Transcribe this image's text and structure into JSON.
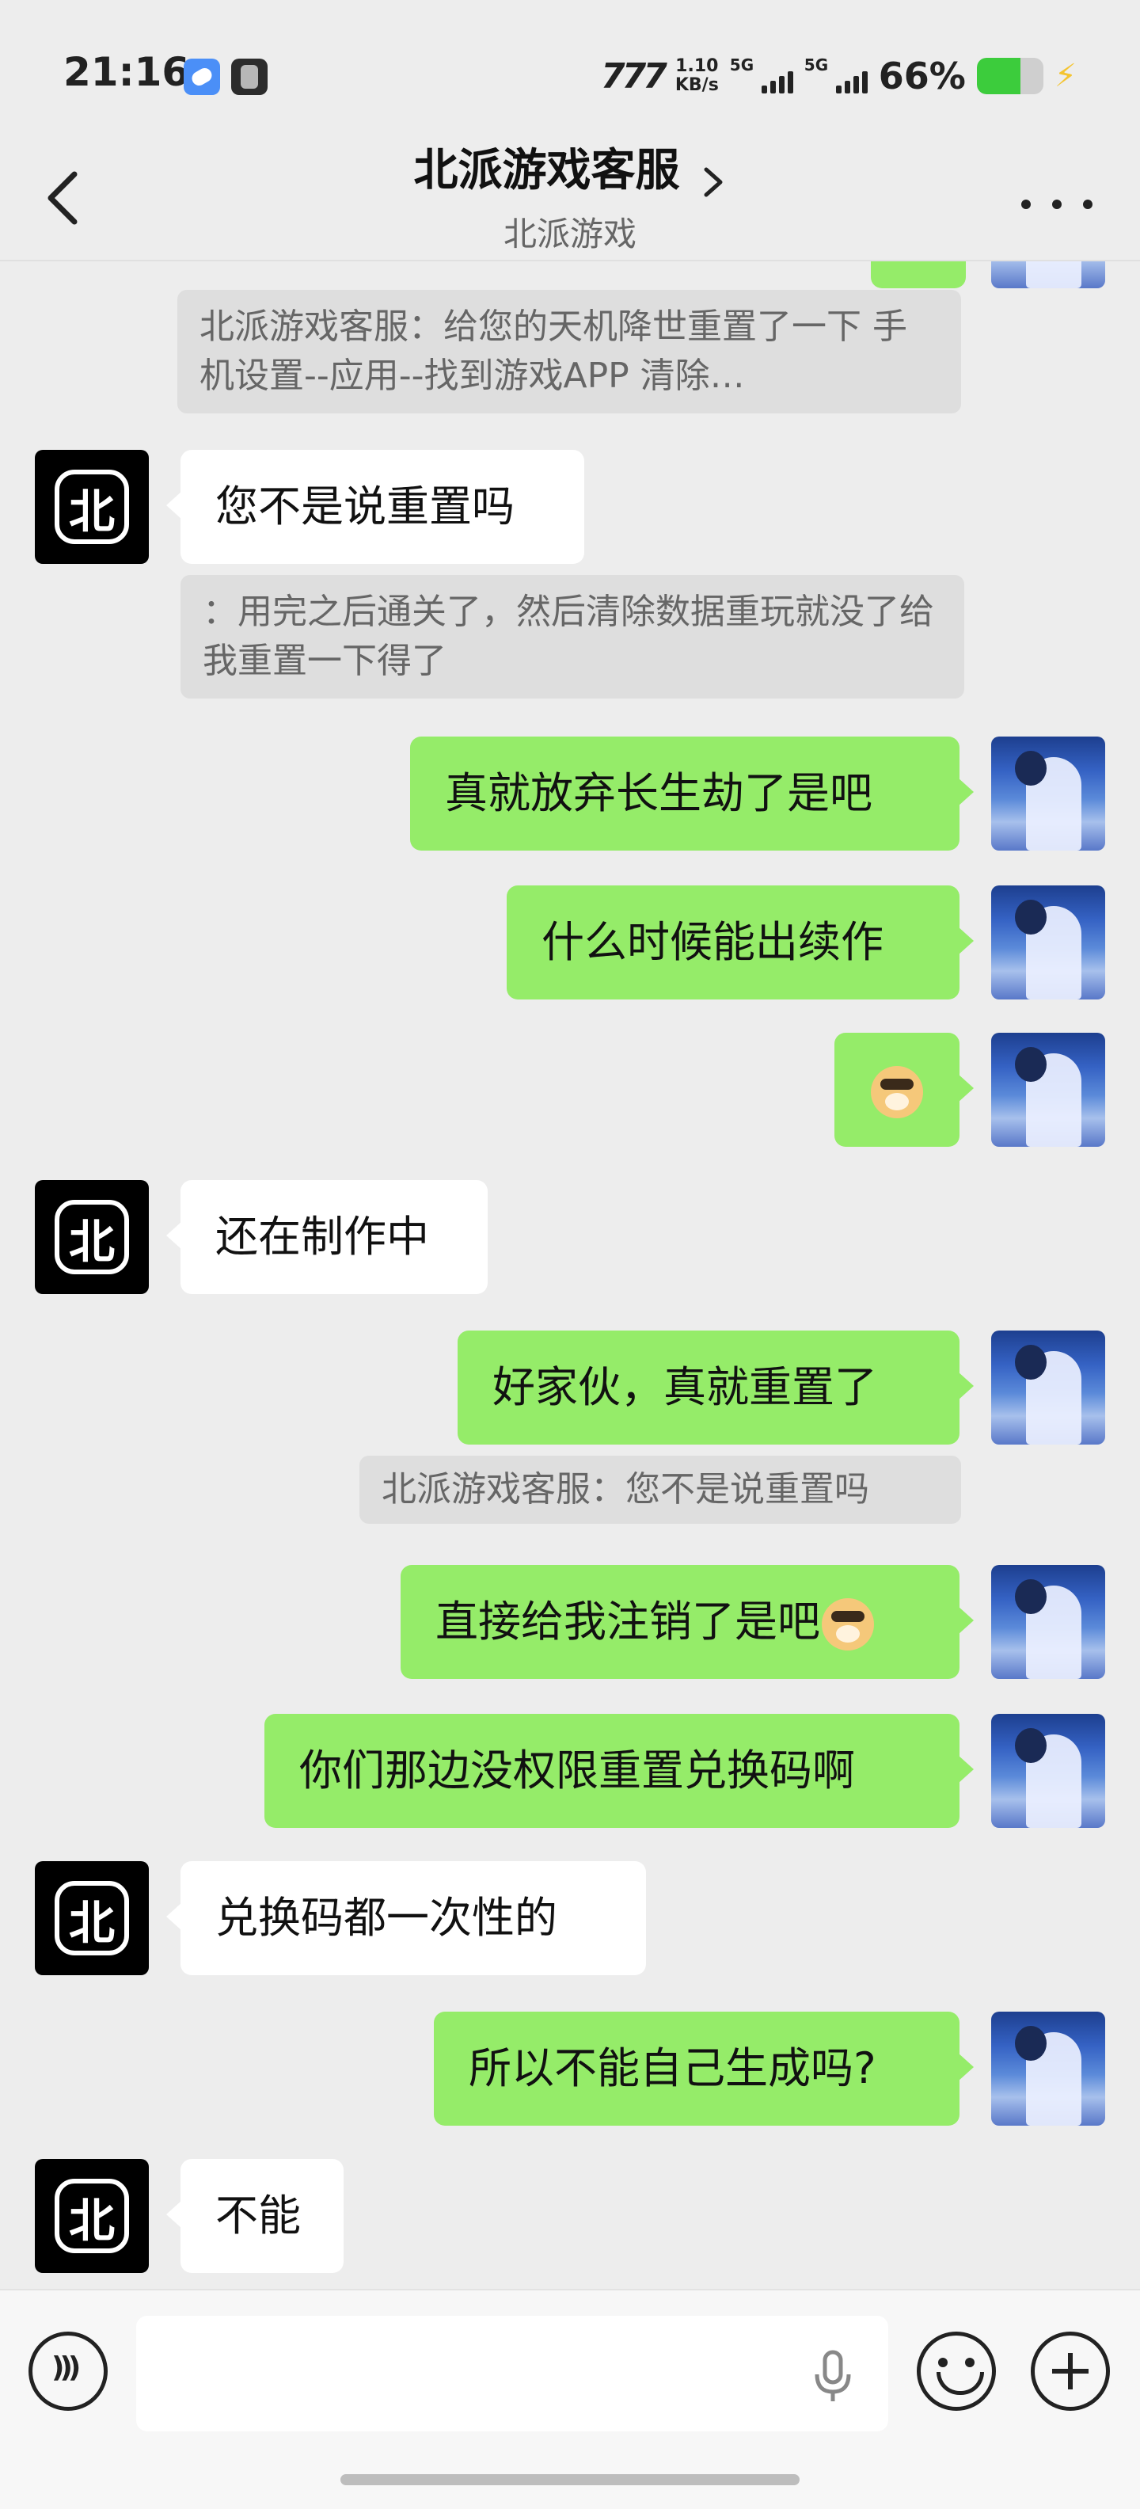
{
  "status_bar": {
    "time": "21:16",
    "nfc": "777",
    "speed_value": "1.10",
    "speed_unit": "KB/s",
    "net1": "5G",
    "net2": "5G",
    "battery_percent_label": "66%",
    "battery_level": 0.66,
    "battery_color": "#3ccc3c"
  },
  "header": {
    "title": "北派游戏客服",
    "subtitle": "北派游戏"
  },
  "service_avatar_text": "北",
  "messages": [
    {
      "quote": "北派游戏客服：给您的天机降世重置了一下  手机设置--应用--找到游戏APP 清除…"
    },
    {
      "text": "您不是说重置吗"
    },
    {
      "quote": "：用完之后通关了，然后清除数据重玩就没了给我重置一下得了"
    },
    {
      "text": "真就放弃长生劫了是吧"
    },
    {
      "text": "什么时候能出续作"
    },
    {
      "emoji": "doge-emoji"
    },
    {
      "text": "还在制作中"
    },
    {
      "text": "好家伙，真就重置了"
    },
    {
      "quote": "北派游戏客服：您不是说重置吗"
    },
    {
      "text": "直接给我注销了是吧"
    },
    {
      "text": "你们那边没权限重置兑换码啊"
    },
    {
      "text": "兑换码都一次性的"
    },
    {
      "text": "所以不能自己生成吗?"
    },
    {
      "text": "不能"
    }
  ],
  "colors": {
    "background": "#ededed",
    "my_bubble": "#95ec69",
    "their_bubble": "#ffffff",
    "quote_bg": "#dedede"
  },
  "icons": [
    "back-chevron-icon",
    "title-chevron-icon",
    "more-dots-icon",
    "voice-icon",
    "mic-icon",
    "emoji-face-icon",
    "plus-icon"
  ]
}
